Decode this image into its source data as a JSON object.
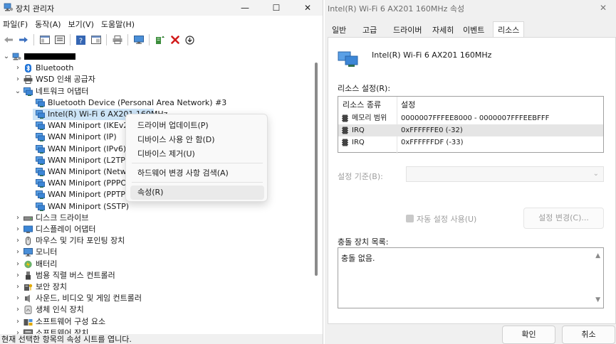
{
  "device_manager": {
    "title": "장치 관리자",
    "window_buttons": {
      "minimize": "—",
      "maximize": "☐",
      "close": "✕"
    },
    "menu": [
      "파일(F)",
      "동작(A)",
      "보기(V)",
      "도움말(H)"
    ],
    "tree": [
      {
        "label": "",
        "level": 0,
        "expander": "⌄",
        "icon": "computer-icon",
        "redacted": true
      },
      {
        "label": "Bluetooth",
        "level": 1,
        "expander": "›",
        "icon": "bluetooth-icon"
      },
      {
        "label": "WSD 인쇄 공급자",
        "level": 1,
        "expander": "›",
        "icon": "printer-icon"
      },
      {
        "label": "네트워크 어댑터",
        "level": 1,
        "expander": "⌄",
        "icon": "network-adapter-icon"
      },
      {
        "label": "Bluetooth Device (Personal Area Network) #3",
        "level": 2,
        "expander": "",
        "icon": "network-adapter-icon"
      },
      {
        "label": "Intel(R) Wi-Fi 6 AX201 160MHz",
        "level": 2,
        "expander": "",
        "icon": "network-adapter-icon",
        "selected": true
      },
      {
        "label": "WAN Miniport (IKEv2)",
        "level": 2,
        "expander": "",
        "icon": "network-adapter-icon"
      },
      {
        "label": "WAN Miniport (IP)",
        "level": 2,
        "expander": "",
        "icon": "network-adapter-icon"
      },
      {
        "label": "WAN Miniport (IPv6)",
        "level": 2,
        "expander": "",
        "icon": "network-adapter-icon"
      },
      {
        "label": "WAN Miniport (L2TP)",
        "level": 2,
        "expander": "",
        "icon": "network-adapter-icon"
      },
      {
        "label": "WAN Miniport (Network Monitor)",
        "level": 2,
        "expander": "",
        "icon": "network-adapter-icon"
      },
      {
        "label": "WAN Miniport (PPPOE)",
        "level": 2,
        "expander": "",
        "icon": "network-adapter-icon"
      },
      {
        "label": "WAN Miniport (PPTP)",
        "level": 2,
        "expander": "",
        "icon": "network-adapter-icon"
      },
      {
        "label": "WAN Miniport (SSTP)",
        "level": 2,
        "expander": "",
        "icon": "network-adapter-icon"
      },
      {
        "label": "디스크 드라이브",
        "level": 1,
        "expander": "›",
        "icon": "disk-drive-icon"
      },
      {
        "label": "디스플레이 어댑터",
        "level": 1,
        "expander": "›",
        "icon": "display-adapter-icon"
      },
      {
        "label": "마우스 및 기타 포인팅 장치",
        "level": 1,
        "expander": "›",
        "icon": "mouse-icon"
      },
      {
        "label": "모니터",
        "level": 1,
        "expander": "›",
        "icon": "monitor-icon"
      },
      {
        "label": "배터리",
        "level": 1,
        "expander": "›",
        "icon": "battery-icon"
      },
      {
        "label": "범용 직렬 버스 컨트롤러",
        "level": 1,
        "expander": "›",
        "icon": "usb-icon"
      },
      {
        "label": "보안 장치",
        "level": 1,
        "expander": "›",
        "icon": "security-device-icon"
      },
      {
        "label": "사운드, 비디오 및 게임 컨트롤러",
        "level": 1,
        "expander": "›",
        "icon": "sound-icon"
      },
      {
        "label": "생체 인식 장치",
        "level": 1,
        "expander": "›",
        "icon": "biometric-icon"
      },
      {
        "label": "소프트웨어 구성 요소",
        "level": 1,
        "expander": "›",
        "icon": "software-component-icon"
      },
      {
        "label": "소프트웨어 장치",
        "level": 1,
        "expander": "›",
        "icon": "software-device-icon"
      }
    ],
    "context_menu": [
      {
        "label": "드라이버 업데이트(P)"
      },
      {
        "label": "디바이스 사용 안 함(D)"
      },
      {
        "label": "디바이스 제거(U)"
      },
      {
        "label": "하드웨어 변경 사항 검색(A)"
      },
      {
        "label": "속성(R)",
        "highlighted": true
      }
    ],
    "status_text": "현재 선택한 항목의 속성 시트를 엽니다."
  },
  "properties": {
    "title": "Intel(R) Wi-Fi 6 AX201 160MHz 속성",
    "tabs": [
      "일반",
      "고급",
      "드라이버",
      "자세히",
      "이벤트",
      "리소스"
    ],
    "active_tab": "리소스",
    "device_name": "Intel(R) Wi-Fi 6 AX201 160MHz",
    "resource_settings_label": "리소스 설정(R):",
    "table_headers": {
      "type": "리소스 종류",
      "setting": "설정"
    },
    "resources": [
      {
        "type": "메모리 범위",
        "setting": "0000007FFFEE8000 - 0000007FFFEEBFFF"
      },
      {
        "type": "IRQ",
        "setting": "0xFFFFFFE0 (-32)",
        "selected": true
      },
      {
        "type": "IRQ",
        "setting": "0xFFFFFFDF (-33)"
      }
    ],
    "setting_based_on_label": "설정 기준(B):",
    "auto_settings_label": "자동 설정 사용(U)",
    "change_setting_button": "설정 변경(C)...",
    "conflict_label": "충돌 장치 목록:",
    "conflict_text": "충돌 없음.",
    "ok_button": "확인",
    "cancel_button": "취소"
  },
  "colors": {
    "selection": "#cce4f7",
    "menu_highlight": "#eaeaea",
    "red_x": "#d11b1b",
    "accent_blue": "#1e73d8"
  }
}
